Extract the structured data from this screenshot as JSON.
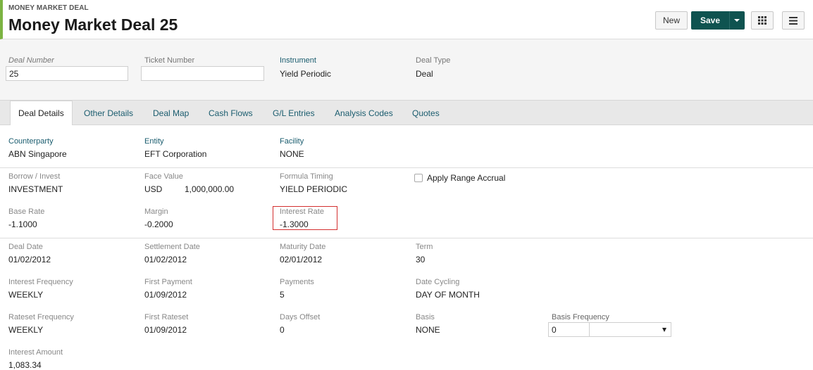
{
  "header": {
    "eyebrow": "MONEY MARKET DEAL",
    "title": "Money Market Deal 25",
    "new_label": "New",
    "save_label": "Save",
    "grid_icon": "grid-icon",
    "menu_icon": "hamburger-menu-icon"
  },
  "summary": {
    "deal_number_label": "Deal Number",
    "deal_number_value": "25",
    "ticket_number_label": "Ticket Number",
    "ticket_number_value": "",
    "instrument_label": "Instrument",
    "instrument_value": "Yield Periodic",
    "deal_type_label": "Deal Type",
    "deal_type_value": "Deal"
  },
  "tabs": [
    {
      "label": "Deal Details",
      "active": true
    },
    {
      "label": "Other Details"
    },
    {
      "label": "Deal Map"
    },
    {
      "label": "Cash Flows"
    },
    {
      "label": "G/L Entries"
    },
    {
      "label": "Analysis Codes"
    },
    {
      "label": "Quotes"
    }
  ],
  "details": {
    "counterparty_label": "Counterparty",
    "counterparty_value": "ABN Singapore",
    "entity_label": "Entity",
    "entity_value": "EFT Corporation",
    "facility_label": "Facility",
    "facility_value": "NONE",
    "borrow_invest_label": "Borrow / Invest",
    "borrow_invest_value": "INVESTMENT",
    "face_value_label": "Face Value",
    "face_value_currency": "USD",
    "face_value_amount": "1,000,000.00",
    "formula_timing_label": "Formula Timing",
    "formula_timing_value": "YIELD PERIODIC",
    "apply_range_accrual_label": "Apply Range Accrual",
    "apply_range_accrual_checked": false,
    "base_rate_label": "Base Rate",
    "base_rate_value": "-1.1000",
    "margin_label": "Margin",
    "margin_value": "-0.2000",
    "interest_rate_label": "Interest Rate",
    "interest_rate_value": "-1.3000",
    "deal_date_label": "Deal Date",
    "deal_date_value": "01/02/2012",
    "settlement_date_label": "Settlement Date",
    "settlement_date_value": "01/02/2012",
    "maturity_date_label": "Maturity Date",
    "maturity_date_value": "02/01/2012",
    "term_label": "Term",
    "term_value": "30",
    "interest_frequency_label": "Interest Frequency",
    "interest_frequency_value": "WEEKLY",
    "first_payment_label": "First Payment",
    "first_payment_value": "01/09/2012",
    "payments_label": "Payments",
    "payments_value": "5",
    "date_cycling_label": "Date Cycling",
    "date_cycling_value": "DAY OF MONTH",
    "rateset_frequency_label": "Rateset Frequency",
    "rateset_frequency_value": "WEEKLY",
    "first_rateset_label": "First Rateset",
    "first_rateset_value": "01/09/2012",
    "days_offset_label": "Days Offset",
    "days_offset_value": "0",
    "basis_label": "Basis",
    "basis_value": "NONE",
    "basis_frequency_label": "Basis Frequency",
    "basis_frequency_value": "0",
    "basis_frequency_select": "",
    "interest_amount_label": "Interest Amount",
    "interest_amount_value": "1,083.34"
  },
  "colors": {
    "accent_bar": "#7cb342",
    "save_button": "#0f5350",
    "link_label": "#1a5c6e",
    "highlight_border": "#d32f2f"
  }
}
